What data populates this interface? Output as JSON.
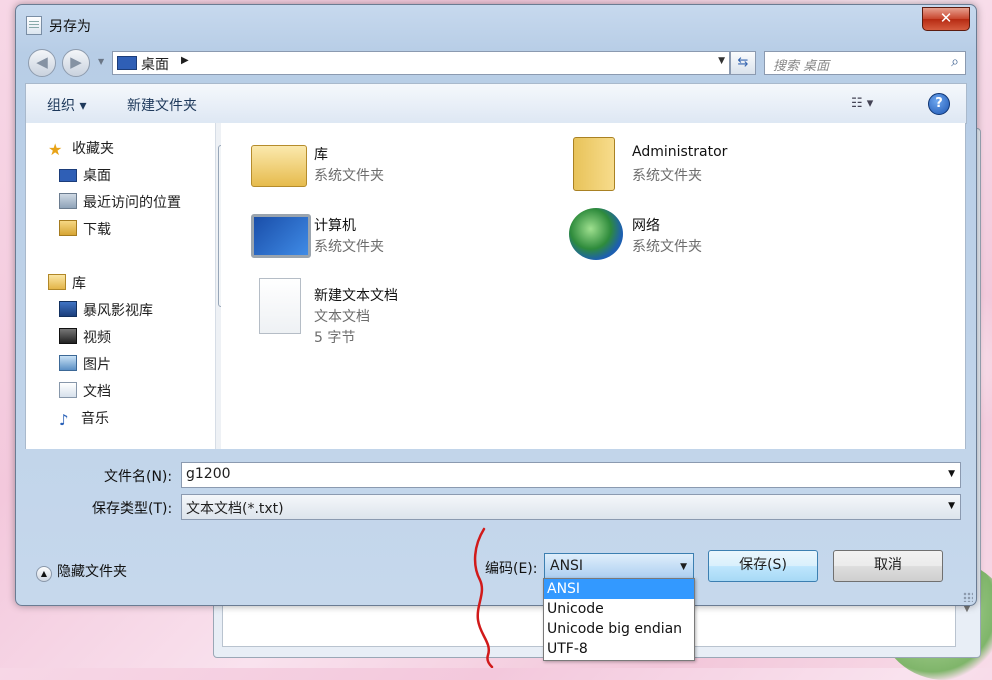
{
  "window": {
    "title": "另存为",
    "close_glyph": "✕"
  },
  "nav": {
    "back_glyph": "◀",
    "forward_glyph": "▶",
    "address": "桌面",
    "address_arrow": "▶",
    "refresh_glyph": "⇆",
    "search_placeholder": "搜索 桌面"
  },
  "toolbar": {
    "organize": "组织 ▾",
    "new_folder": "新建文件夹",
    "view": "☷ ▾",
    "help": "?"
  },
  "sidebar": {
    "favorites": "收藏夹",
    "desktop": "桌面",
    "recent": "最近访问的位置",
    "downloads": "下载",
    "libraries": "库",
    "baofeng": "暴风影视库",
    "videos": "视频",
    "pictures": "图片",
    "documents": "文档",
    "music": "音乐"
  },
  "items": [
    {
      "name": "库",
      "type": "系统文件夹"
    },
    {
      "name": "Administrator",
      "type": "系统文件夹"
    },
    {
      "name": "计算机",
      "type": "系统文件夹"
    },
    {
      "name": "网络",
      "type": "系统文件夹"
    },
    {
      "name": "新建文本文档",
      "type": "文本文档",
      "size": "5 字节"
    }
  ],
  "form": {
    "filename_label": "文件名(N):",
    "filename_value": "g1200",
    "filetype_label": "保存类型(T):",
    "filetype_value": "文本文档(*.txt)",
    "hide_folders": "隐藏文件夹",
    "encoding_label": "编码(E):",
    "encoding_value": "ANSI",
    "save": "保存(S)",
    "cancel": "取消"
  },
  "encoding_options": [
    "ANSI",
    "Unicode",
    "Unicode big endian",
    "UTF-8"
  ],
  "colors": {
    "selection": "#3399ff",
    "annotation": "#d11a1a",
    "title_bar": "#b7cde6"
  }
}
